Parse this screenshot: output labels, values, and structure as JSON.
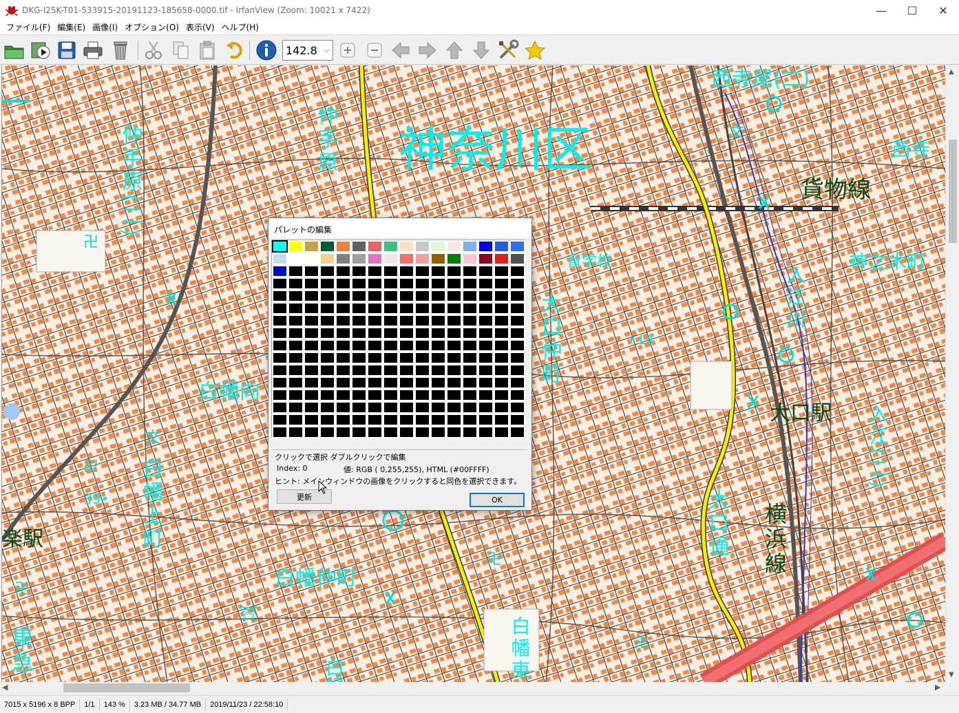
{
  "window": {
    "title": "DKG-I25K-T01-533915-20191123-185658-0000.tif - IrfanView (Zoom: 10021 x 7422)",
    "minimize": "—",
    "maximize": "☐",
    "close": "✕"
  },
  "menu": {
    "items": [
      "ファイル(F)",
      "編集(E)",
      "画像(I)",
      "オプション(O)",
      "表示(V)",
      "ヘルプ(H)"
    ]
  },
  "toolbar": {
    "buttons": [
      "open-icon",
      "slideshow-icon",
      "save-icon",
      "print-icon",
      "delete-icon",
      "cut-icon",
      "copy-icon",
      "paste-icon",
      "undo-icon",
      "info-icon",
      "zoom-in-icon",
      "zoom-out-icon",
      "previous-icon",
      "next-icon",
      "first-icon",
      "last-icon",
      "settings-icon",
      "favorite-icon"
    ],
    "zoom_value": "142.8"
  },
  "map": {
    "labels": {
      "kanagawa_ku": "神奈川区",
      "nishiteraomachi": "西寺尾(二)",
      "nishitera": "西寺",
      "kamotsusen": "貨物線",
      "nakatebara_left": "仲手原(二)",
      "nakatebara_mid": "仲手原",
      "moujakko": "盲学校",
      "kaminokimachi": "神之木町",
      "irie_gawa": "入江川",
      "oguchi_nakamachi": "大口仲町",
      "elevation": "•14",
      "hakuraku_mukai": "白幡向",
      "oguchi_eki": "大口駅",
      "irie_right": "入江(二)",
      "hakuraku_kamimachi": "白幡上町",
      "elevation2": "39•",
      "rakueki": "楽駅",
      "oguchi_dori": "大口通",
      "yokohama_sen": "横浜線",
      "hakuraku_nakamachi": "白幡仲町",
      "toukyu": "東急",
      "hakuraku_lower": "白幡",
      "hakuraku_higashi": "白幡東"
    }
  },
  "scrollbars": {
    "up": "▲",
    "down": "▼",
    "left": "◀",
    "right": "▶"
  },
  "status": {
    "dimensions": "7015 x 5196 x 8 BPP",
    "page": "1/1",
    "zoom": "143 %",
    "size": "3.23 MB / 34.77 MB",
    "datetime": "2019/11/23 / 22:58:10"
  },
  "palette_dialog": {
    "title": "パレットの編集",
    "hint": "クリックで選択 ダブルクリックで編集",
    "index_label": "Index: 0",
    "value_label": "値: RGB (   0,255,255), HTML (#00FFFF)",
    "tip": "ヒント: メインウィンドウの画像をクリックすると同色を選択できます。",
    "update_button": "更新",
    "ok_button": "OK",
    "colors": [
      "#00ffff",
      "#ffff00",
      "#c8a040",
      "#005a32",
      "#f08040",
      "#606060",
      "#f06060",
      "#40c080",
      "#f8e0c0",
      "#c8c8c8",
      "#d8f8d8",
      "#f8e8e0",
      "#80b0e8",
      "#0000ff",
      "#2060e0",
      "#3070f0",
      "#c8d8f0",
      "#ffffff",
      "#fffff0",
      "#f0d090",
      "#808080",
      "#a0a0a0",
      "#e070c0",
      "#f0e8e8",
      "#f07070",
      "#f0a0a0",
      "#906000",
      "#008000",
      "#f8c8d0",
      "#900020",
      "#e02020",
      "#505050",
      "#0010c0"
    ]
  }
}
